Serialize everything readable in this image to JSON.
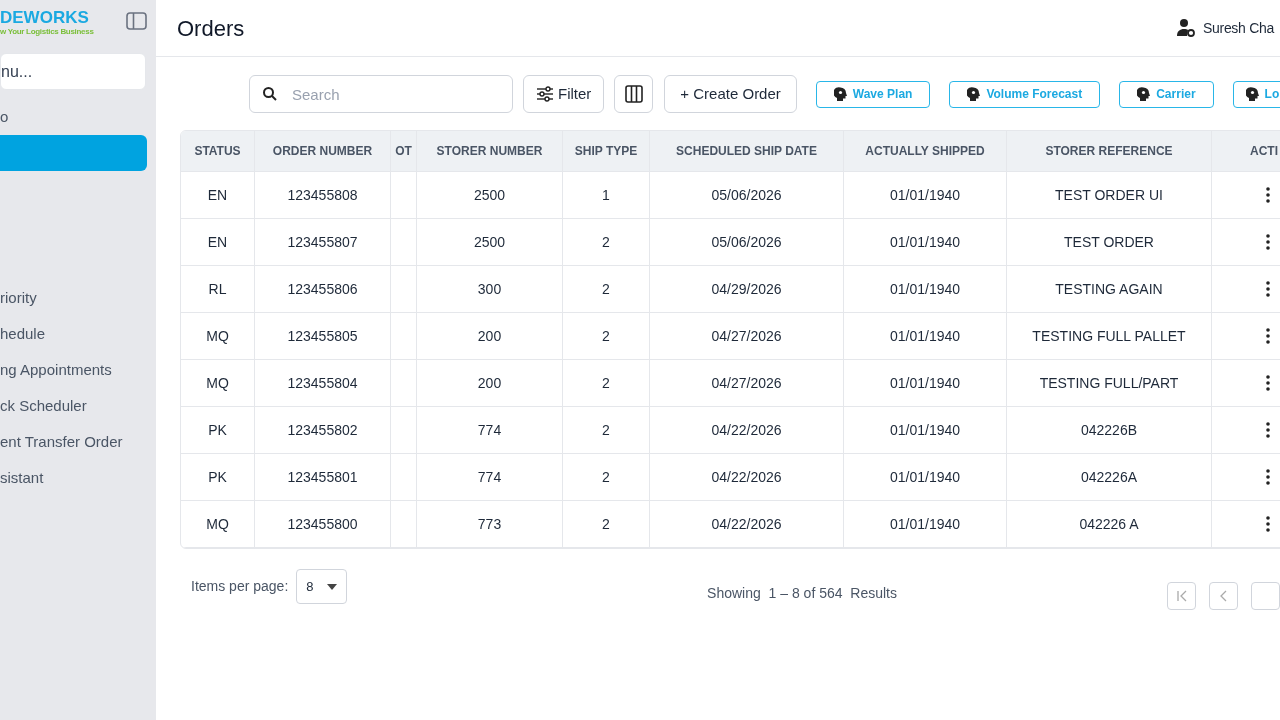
{
  "sidebar": {
    "logo": {
      "name": "DEWORKS",
      "tagline": "w Your Logistics Business"
    },
    "menu_search": {
      "placeholder": "nu..."
    },
    "items_top": [
      {
        "label": "o",
        "selected": false
      },
      {
        "selected": true
      }
    ],
    "items": [
      {
        "label": "riority",
        "selected": false
      },
      {
        "label": "hedule",
        "selected": false
      },
      {
        "label": "ng Appointments",
        "selected": false
      },
      {
        "label": "ck Scheduler",
        "selected": false
      },
      {
        "label": "ent Transfer Order",
        "selected": false
      },
      {
        "label": "sistant",
        "selected": false
      }
    ]
  },
  "header": {
    "title": "Orders",
    "user": "Suresh Cha"
  },
  "toolbar": {
    "search": {
      "placeholder": "Search"
    },
    "filter": "Filter",
    "create": "+ Create Order",
    "ai_buttons": [
      "Wave Plan",
      "Volume Forecast",
      "Carrier",
      "Lo"
    ]
  },
  "table": {
    "columns": [
      "STATUS",
      "ORDER NUMBER",
      "OT",
      "STORER NUMBER",
      "SHIP TYPE",
      "SCHEDULED SHIP DATE",
      "ACTUALLY SHIPPED",
      "STORER REFERENCE",
      "ACTI"
    ],
    "rows": [
      [
        "EN",
        "123455808",
        "",
        "2500",
        "1",
        "05/06/2026",
        "01/01/1940",
        "TEST ORDER UI"
      ],
      [
        "EN",
        "123455807",
        "",
        "2500",
        "2",
        "05/06/2026",
        "01/01/1940",
        "TEST ORDER"
      ],
      [
        "RL",
        "123455806",
        "",
        "300",
        "2",
        "04/29/2026",
        "01/01/1940",
        "TESTING AGAIN"
      ],
      [
        "MQ",
        "123455805",
        "",
        "200",
        "2",
        "04/27/2026",
        "01/01/1940",
        "TESTING FULL PALLET"
      ],
      [
        "MQ",
        "123455804",
        "",
        "200",
        "2",
        "04/27/2026",
        "01/01/1940",
        "TESTING FULL/PART"
      ],
      [
        "PK",
        "123455802",
        "",
        "774",
        "2",
        "04/22/2026",
        "01/01/1940",
        "042226B"
      ],
      [
        "PK",
        "123455801",
        "",
        "774",
        "2",
        "04/22/2026",
        "01/01/1940",
        "042226A"
      ],
      [
        "MQ",
        "123455800",
        "",
        "773",
        "2",
        "04/22/2026",
        "01/01/1940",
        "042226 A"
      ]
    ]
  },
  "pagination": {
    "items_per_page_label": "Items per page:",
    "items_per_page": "8",
    "showing": "Showing  1 – 8 of 564  Results"
  }
}
